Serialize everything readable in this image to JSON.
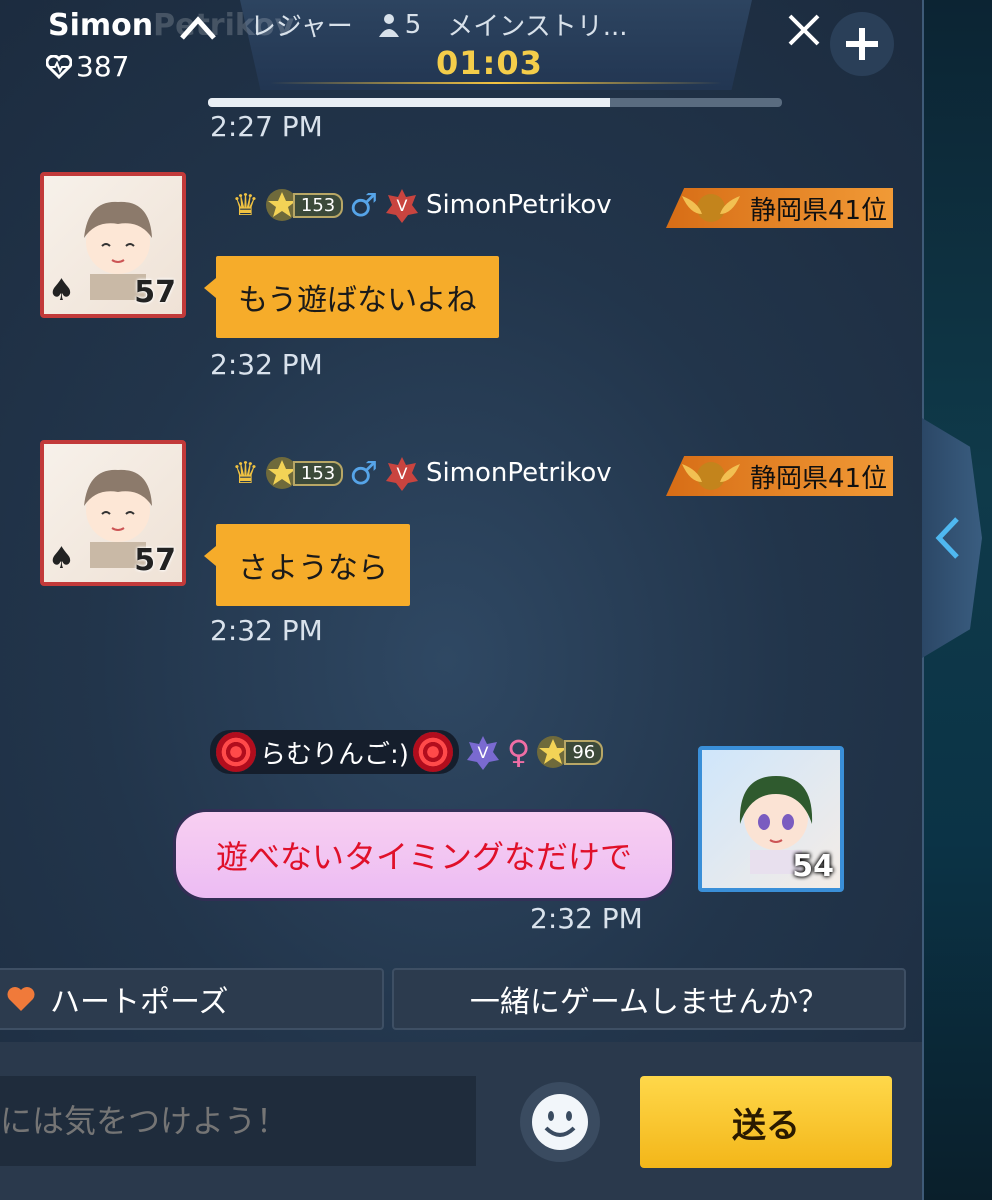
{
  "header": {
    "user_name": "Simon",
    "user_name_ghost": "Petrikov",
    "hearts": "387",
    "room_category": "レジャー",
    "room_people": "5",
    "room_name": "メインストリ...",
    "timer": "01:03",
    "room_progress_percent": 70
  },
  "messages": [
    {
      "time": "2:27 PM"
    },
    {
      "sender": "SimonPetrikov",
      "star_level": "153",
      "level": "57",
      "prefecture_rank": "静岡県41位",
      "text": "もう遊ばないよね",
      "time": "2:32 PM"
    },
    {
      "sender": "SimonPetrikov",
      "star_level": "153",
      "level": "57",
      "prefecture_rank": "静岡県41位",
      "text": "さようなら",
      "time": "2:32 PM"
    },
    {
      "sender": "らむりんご:)",
      "star_level": "96",
      "level": "54",
      "text": "遊べないタイミングなだけで",
      "time": "2:32 PM"
    }
  ],
  "quick_replies": [
    "ハートポーズ",
    "一緒にゲームしませんか？"
  ],
  "input": {
    "placeholder": "には気をつけよう！"
  },
  "send_label": "送る",
  "colors": {
    "accent": "#f6ac2a",
    "timer": "#f4cd4a",
    "send": "#ffd84a",
    "pink": "#f8cff2"
  }
}
